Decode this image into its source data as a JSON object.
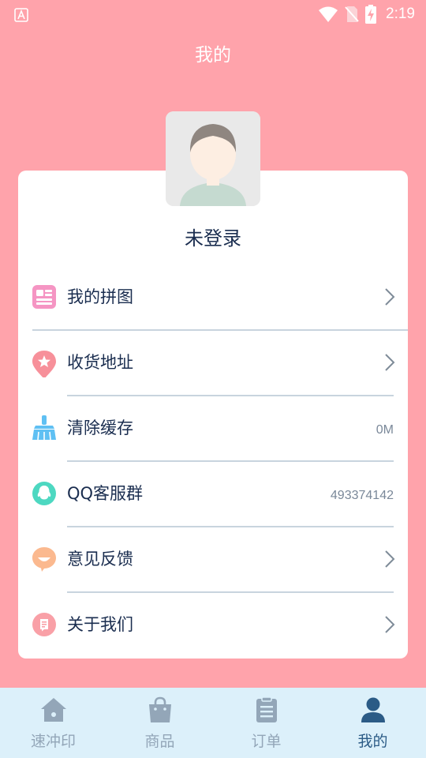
{
  "status_bar": {
    "time": "2:19",
    "icons": [
      "app-a-icon",
      "wifi-icon",
      "no-sim-icon",
      "battery-charging-icon"
    ]
  },
  "header": {
    "title": "我的"
  },
  "profile": {
    "username": "未登录",
    "avatar_icon": "default-avatar-icon"
  },
  "menu": [
    {
      "label": "我的拼图",
      "icon": "puzzle-icon",
      "value": null,
      "chevron": true,
      "color": "#f595c3"
    },
    {
      "label": "收货地址",
      "icon": "location-pin-icon",
      "value": null,
      "chevron": true,
      "color": "#f7909a"
    },
    {
      "label": "清除缓存",
      "icon": "broom-icon",
      "value": "0M",
      "chevron": false,
      "color": "#5fc0f3"
    },
    {
      "label": "QQ客服群",
      "icon": "qq-icon",
      "value": "493374142",
      "chevron": false,
      "color": "#4dd8c1"
    },
    {
      "label": "意见反馈",
      "icon": "feedback-icon",
      "value": null,
      "chevron": true,
      "color": "#fbb98f"
    },
    {
      "label": "关于我们",
      "icon": "about-icon",
      "value": null,
      "chevron": true,
      "color": "#f9a0a7"
    }
  ],
  "tabs": [
    {
      "label": "速冲印",
      "icon": "home-icon",
      "active": false
    },
    {
      "label": "商品",
      "icon": "shopping-bag-icon",
      "active": false
    },
    {
      "label": "订单",
      "icon": "clipboard-icon",
      "active": false
    },
    {
      "label": "我的",
      "icon": "person-icon",
      "active": true
    }
  ],
  "colors": {
    "background": "#ffa3ab",
    "card": "#ffffff",
    "text_primary": "#1a2d4f",
    "tab_bar": "#dcf0fa",
    "tab_active": "#2b5b86",
    "tab_inactive": "#93a6b8"
  }
}
